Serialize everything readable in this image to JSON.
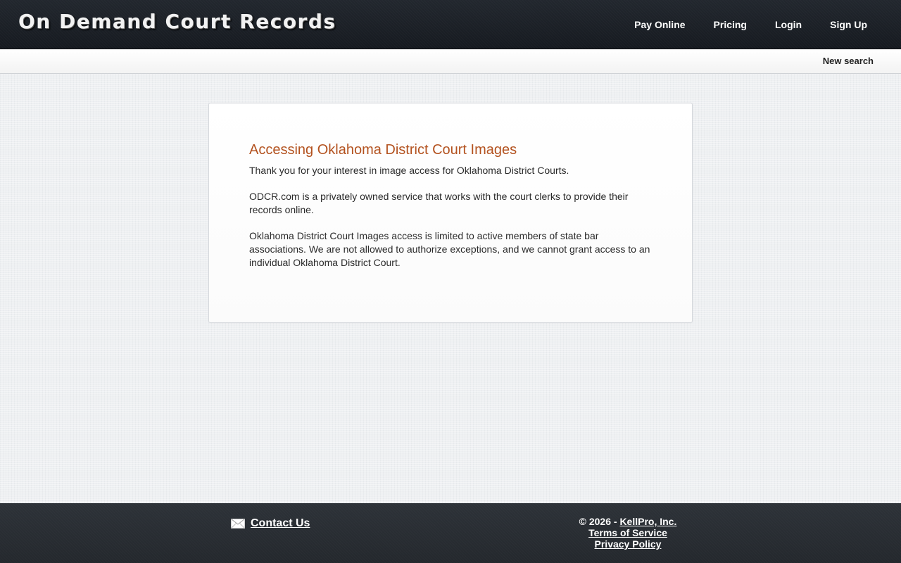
{
  "header": {
    "brand": "On Demand Court Records",
    "nav": {
      "pay_online": "Pay Online",
      "pricing": "Pricing",
      "login": "Login",
      "sign_up": "Sign Up"
    }
  },
  "subbar": {
    "new_search": "New search"
  },
  "content": {
    "title": "Accessing Oklahoma District Court Images",
    "paragraphs": [
      "Thank you for your interest in image access for Oklahoma District Courts.",
      "ODCR.com is a privately owned service that works with the court clerks to provide their records online.",
      "Oklahoma District Court Images access is limited to active members of state bar associations. We are not allowed to authorize exceptions, and we cannot grant access to an individual Oklahoma District Court."
    ]
  },
  "footer": {
    "contact_label": "Contact Us",
    "contact_icon": "mail-icon",
    "copyright_prefix": "© 2026 - ",
    "company": "KellPro, Inc.",
    "terms": "Terms of Service",
    "privacy": "Privacy Policy"
  },
  "colors": {
    "header_bg": "#1b1f25",
    "title_accent": "#b3521f",
    "footer_bg": "#2a2f35"
  }
}
